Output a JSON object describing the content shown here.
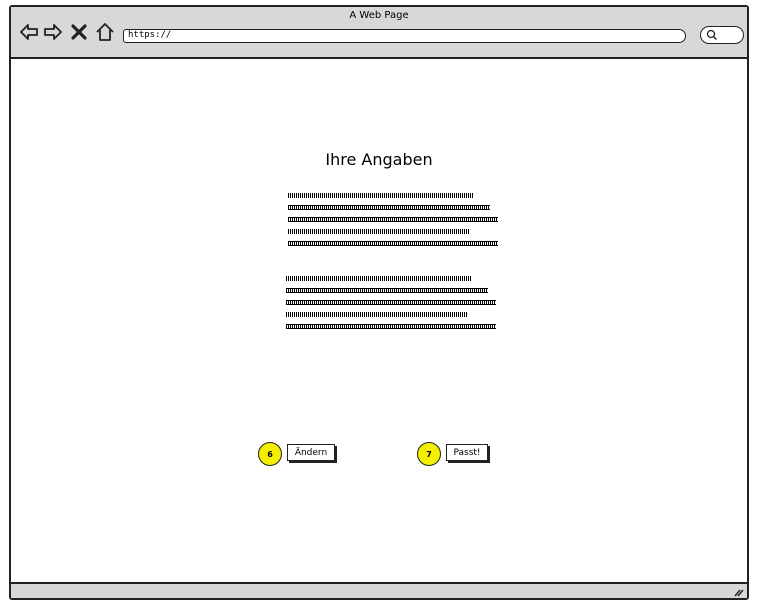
{
  "window": {
    "title": "A Web Page",
    "url": "https://"
  },
  "icons": {
    "back": "back-arrow-icon",
    "forward": "forward-arrow-icon",
    "stop": "close-icon",
    "home": "home-icon",
    "search": "search-icon",
    "resize": "resize-grip-icon"
  },
  "page": {
    "heading": "Ihre Angaben",
    "paragraphs": [
      {
        "lines": [
          88,
          96,
          100,
          86,
          100
        ]
      },
      {
        "lines": [
          88,
          96,
          100,
          86,
          100
        ]
      }
    ]
  },
  "actions": {
    "change": {
      "label": "Ändern",
      "badge": "6"
    },
    "confirm": {
      "label": "Passt!",
      "badge": "7"
    }
  },
  "colors": {
    "chrome": "#d8d8d8",
    "badge": "#f4ef00"
  }
}
